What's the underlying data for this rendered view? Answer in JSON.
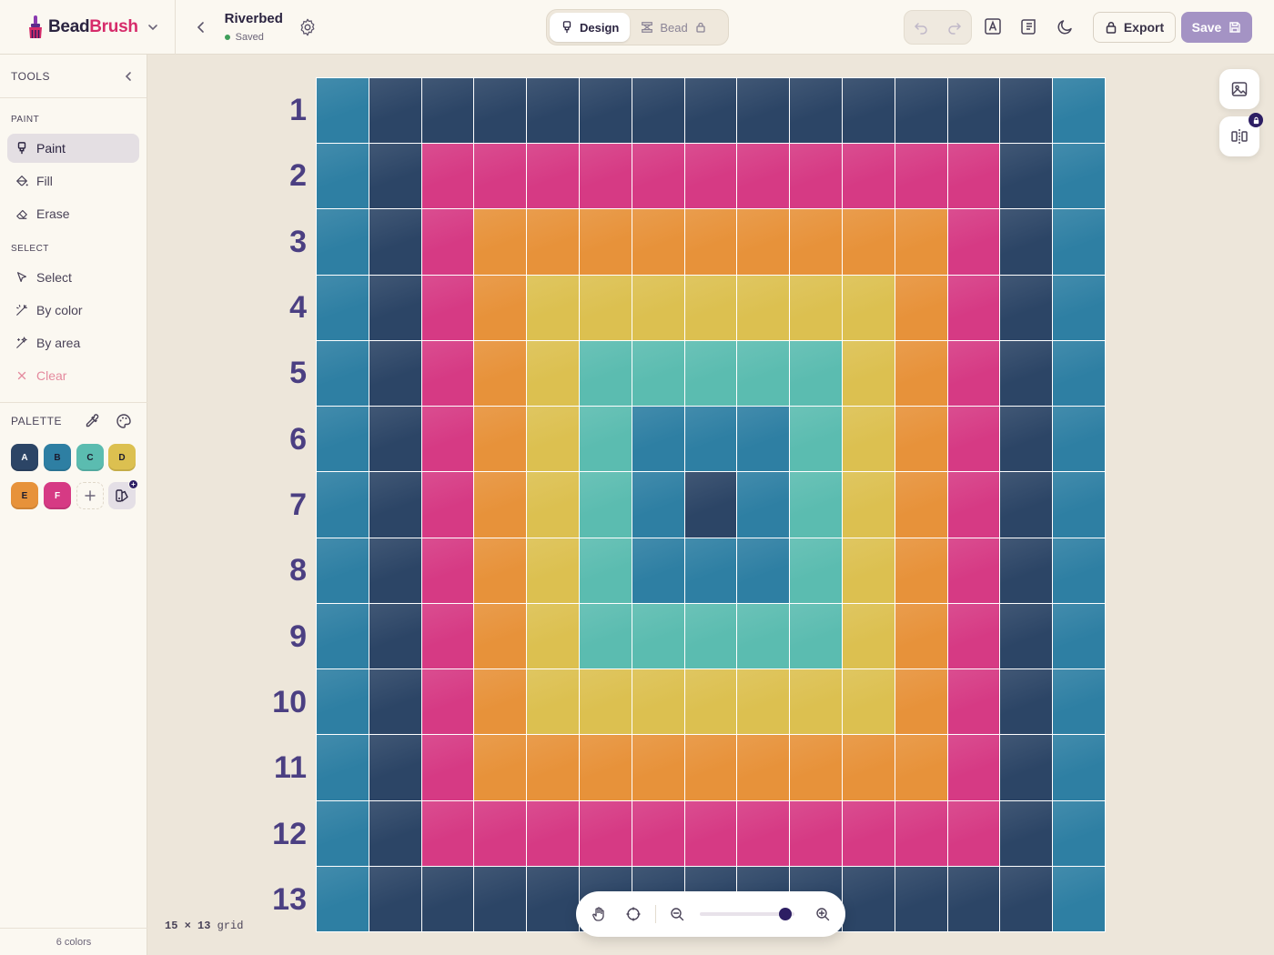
{
  "brand": {
    "name_part1": "Bead",
    "name_part2": "Brush"
  },
  "document": {
    "title": "Riverbed",
    "status": "Saved"
  },
  "modes": [
    {
      "label": "Design",
      "active": true,
      "locked": false
    },
    {
      "label": "Bead",
      "active": false,
      "locked": true
    }
  ],
  "toolbar": {
    "export_label": "Export",
    "save_label": "Save"
  },
  "sidebar": {
    "title": "TOOLS",
    "sections": {
      "paint": "PAINT",
      "select": "SELECT",
      "palette": "PALETTE"
    },
    "paint_tools": [
      {
        "label": "Paint",
        "icon": "brush-icon",
        "active": true
      },
      {
        "label": "Fill",
        "icon": "bucket-icon",
        "active": false
      },
      {
        "label": "Erase",
        "icon": "eraser-icon",
        "active": false
      }
    ],
    "select_tools": [
      {
        "label": "Select",
        "icon": "cursor-icon"
      },
      {
        "label": "By color",
        "icon": "magic-wand-icon"
      },
      {
        "label": "By area",
        "icon": "sparkle-wand-icon"
      },
      {
        "label": "Clear",
        "icon": "close-icon"
      }
    ],
    "palette": [
      {
        "key": "A",
        "color": "#2c4566",
        "text": "#ffffff"
      },
      {
        "key": "B",
        "color": "#2e7fa3",
        "text": "#1b1b2e"
      },
      {
        "key": "C",
        "color": "#5bbcb0",
        "text": "#1b1b2e"
      },
      {
        "key": "D",
        "color": "#dcc050",
        "text": "#1b1b2e"
      },
      {
        "key": "E",
        "color": "#e7923a",
        "text": "#1b1b2e"
      },
      {
        "key": "F",
        "color": "#d63a84",
        "text": "#ffffff"
      }
    ],
    "footer": "6 colors"
  },
  "canvas": {
    "rows": 13,
    "cols": 15,
    "row_labels": [
      "1",
      "2",
      "3",
      "4",
      "5",
      "6",
      "7",
      "8",
      "9",
      "10",
      "11",
      "12",
      "13"
    ],
    "size_cols": "15",
    "size_x": "×",
    "size_rows": "13",
    "size_word": "grid",
    "zoom_level": 0.9,
    "pattern": [
      "BAAAAAAAAAAAAAB",
      "BAFFFFFFFFFFFAB",
      "BAFEEEEEEEEEFAB",
      "BAFEDDDDDDDEFAB",
      "BAFEDCCCCCDEFAB",
      "BAFEDCBBBCDEFAB",
      "BAFEDCBABCDEFAB",
      "BAFEDCBBBCDEFAB",
      "BAFEDCCCCCDEFAB",
      "BAFEDDDDDDDEFAB",
      "BAFEEEEEEEEEFAB",
      "BAFFFFFFFFFFFAB",
      "BAAAAAAAAAAAAAB"
    ]
  }
}
